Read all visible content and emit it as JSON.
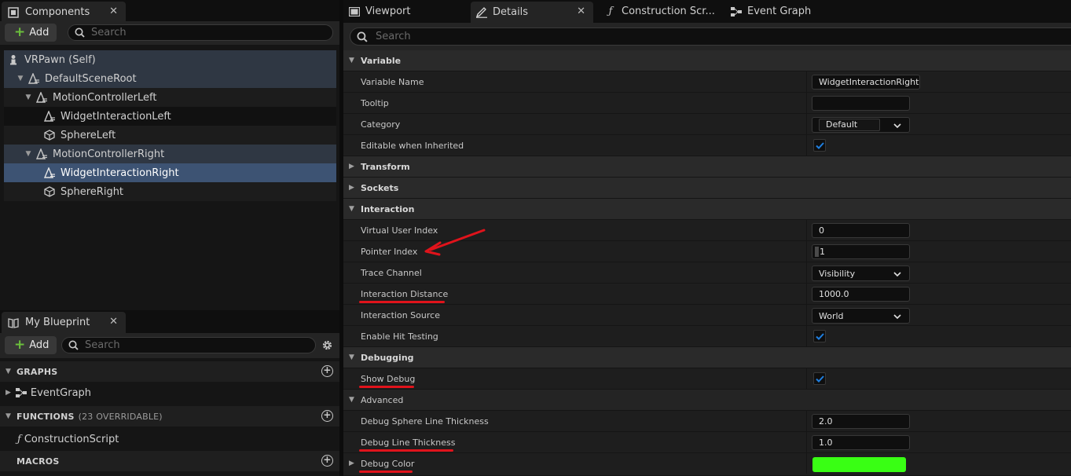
{
  "components_panel": {
    "tab_title": "Components",
    "add_label": "Add",
    "search_placeholder": "Search",
    "tree": [
      {
        "label": "VRPawn (Self)",
        "icon": "pawn-icon"
      },
      {
        "label": "DefaultSceneRoot",
        "icon": "scene-root-icon"
      },
      {
        "label": "MotionControllerLeft",
        "icon": "motion-controller-icon"
      },
      {
        "label": "WidgetInteractionLeft",
        "icon": "widget-interaction-icon"
      },
      {
        "label": "SphereLeft",
        "icon": "static-mesh-icon"
      },
      {
        "label": "MotionControllerRight",
        "icon": "motion-controller-icon"
      },
      {
        "label": "WidgetInteractionRight",
        "icon": "widget-interaction-icon",
        "selected": true
      },
      {
        "label": "SphereRight",
        "icon": "static-mesh-icon"
      }
    ]
  },
  "blueprint_panel": {
    "tab_title": "My Blueprint",
    "add_label": "Add",
    "search_placeholder": "Search",
    "graphs_label": "GRAPHS",
    "graph_item": "EventGraph",
    "functions_label": "FUNCTIONS",
    "functions_sub": "(23 OVERRIDABLE)",
    "function_item": "ConstructionScript",
    "macros_label": "MACROS"
  },
  "editor_tabs": {
    "viewport": "Viewport",
    "details": "Details",
    "construction": "Construction Scr...",
    "event_graph": "Event Graph"
  },
  "details": {
    "search_placeholder": "Search",
    "rows": {
      "variable": "Variable",
      "variable_name": "Variable Name",
      "variable_name_value": "WidgetInteractionRight",
      "tooltip": "Tooltip",
      "tooltip_value": "",
      "category": "Category",
      "category_value": "Default",
      "editable": "Editable when Inherited",
      "transform": "Transform",
      "sockets": "Sockets",
      "interaction": "Interaction",
      "virtual_user_index": "Virtual User Index",
      "virtual_user_index_value": "0",
      "pointer_index": "Pointer Index",
      "pointer_index_value": "1",
      "trace_channel": "Trace Channel",
      "trace_channel_value": "Visibility",
      "interaction_distance": "Interaction Distance",
      "interaction_distance_value": "1000.0",
      "interaction_source": "Interaction Source",
      "interaction_source_value": "World",
      "enable_hit_testing": "Enable Hit Testing",
      "debugging": "Debugging",
      "show_debug": "Show Debug",
      "advanced": "Advanced",
      "debug_sphere_line_thickness": "Debug Sphere Line Thickness",
      "debug_sphere_line_thickness_value": "2.0",
      "debug_line_thickness": "Debug Line Thickness",
      "debug_line_thickness_value": "1.0",
      "debug_color": "Debug Color"
    },
    "checkbox_states": {
      "editable_when_inherited": true,
      "enable_hit_testing": true,
      "show_debug": true
    }
  },
  "colors": {
    "debug_color_swatch": "#39ff14",
    "annotation_red": "#e0131b",
    "selection": "#3d5373",
    "checkmark_blue": "#1f7fe0"
  }
}
